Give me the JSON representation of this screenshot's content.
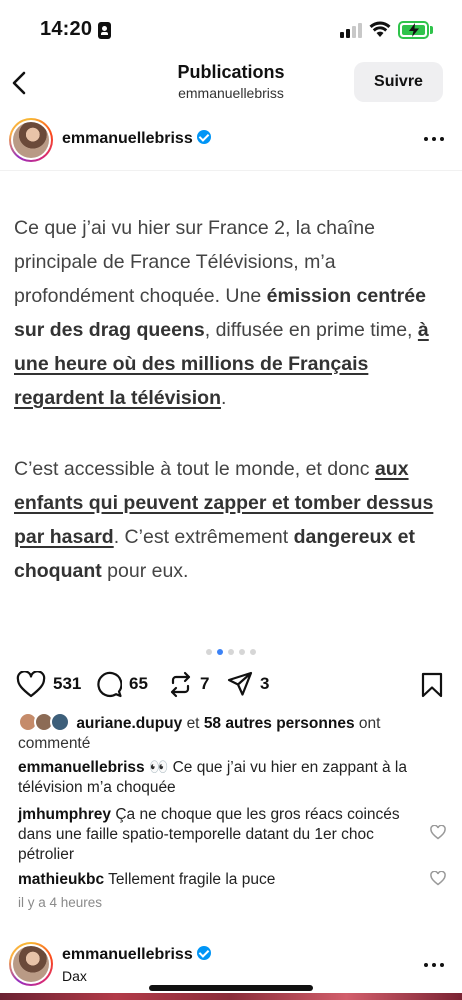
{
  "status_bar": {
    "time": "14:20"
  },
  "nav": {
    "title": "Publications",
    "subtitle": "emmanuellebriss",
    "follow_label": "Suivre"
  },
  "post": {
    "username": "emmanuellebriss",
    "paragraph1": {
      "t1": "Ce que j’ai vu hier sur France 2, la chaîne principale de France Télévisions, m’a profondément choquée. Une ",
      "b1": "émission centrée sur des drag queens",
      "t2": ", diffusée en prime time, ",
      "u1": "à une heure où des millions de Français regardent la télévision",
      "t3": "."
    },
    "paragraph2": {
      "t1": "C’est accessible à tout le monde, et donc ",
      "u1": "aux enfants qui peuvent zapper et tomber dessus par hasard",
      "t2": ". C’est extrêmement ",
      "b1": "dangereux et choquant",
      "t3": " pour eux."
    },
    "carousel": {
      "slides": 5,
      "active": 2
    },
    "actions": {
      "likes": "531",
      "comments": "65",
      "reposts": "7",
      "shares": "3"
    },
    "liked_by": {
      "user": "auriane.dupuy",
      "connector": "et",
      "others": "58 autres personnes",
      "suffix": "ont commenté"
    },
    "caption": {
      "user": "emmanuellebriss",
      "text": "👀 Ce que j’ai vu hier en zappant à la télévision m’a choquée"
    },
    "comments": [
      {
        "user": "jmhumphrey",
        "text": "Ça ne choque que les gros réacs coincés dans une faille spatio-temporelle datant du 1er choc pétrolier"
      },
      {
        "user": "mathieukbc",
        "text": "Tellement fragile la puce"
      }
    ],
    "time_ago": "il y a 4 heures"
  },
  "next_post": {
    "username": "emmanuellebriss",
    "location": "Dax"
  },
  "colors": {
    "verified": "#0095f6",
    "carousel_active": "#3b82f6",
    "battery": "#2fc34b"
  }
}
